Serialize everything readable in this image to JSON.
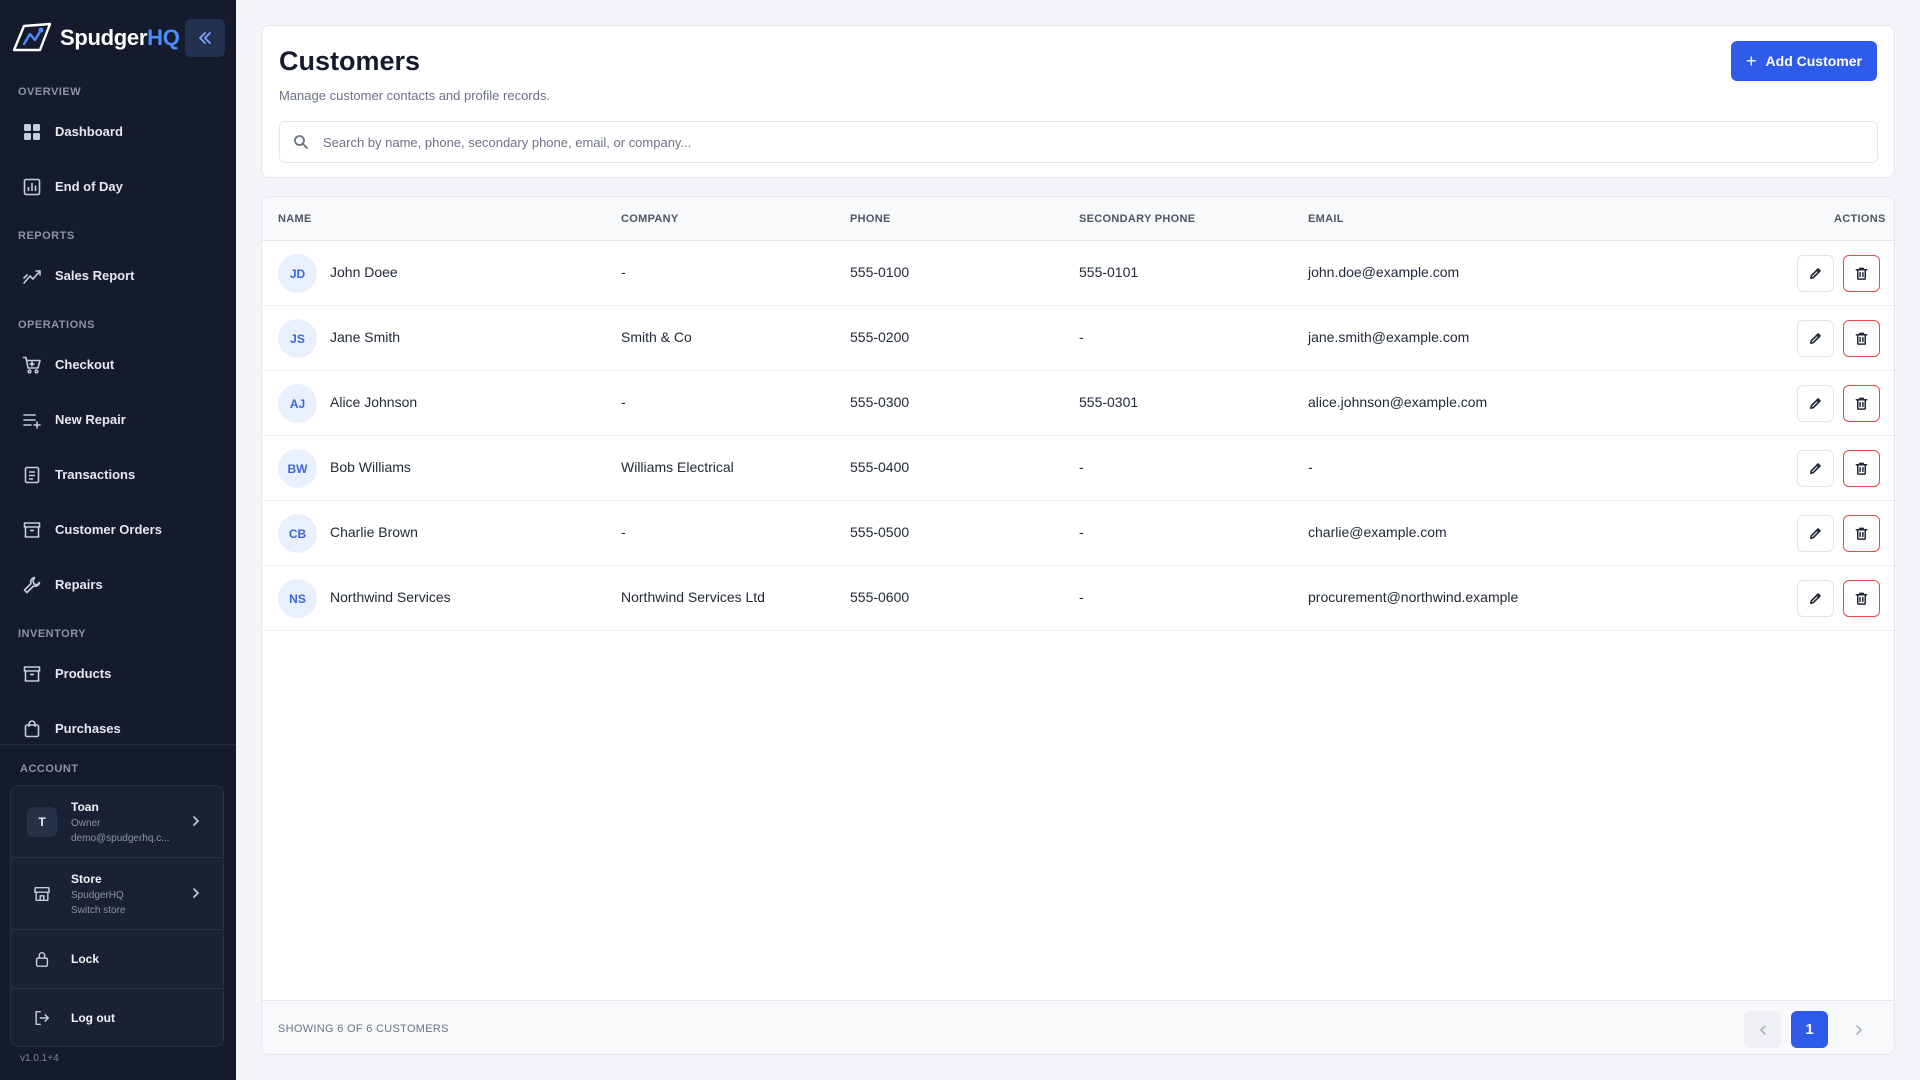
{
  "brand": {
    "name_part1": "Spudger",
    "name_part2": "HQ"
  },
  "sidebar": {
    "sections": [
      {
        "label": "OVERVIEW",
        "items": [
          {
            "label": "Dashboard",
            "icon": "dashboard-icon"
          },
          {
            "label": "End of Day",
            "icon": "chart-icon"
          }
        ]
      },
      {
        "label": "REPORTS",
        "items": [
          {
            "label": "Sales Report",
            "icon": "trend-icon"
          }
        ]
      },
      {
        "label": "OPERATIONS",
        "items": [
          {
            "label": "Checkout",
            "icon": "cart-icon"
          },
          {
            "label": "New Repair",
            "icon": "list-add-icon"
          },
          {
            "label": "Transactions",
            "icon": "receipt-icon"
          },
          {
            "label": "Customer Orders",
            "icon": "archive-icon"
          },
          {
            "label": "Repairs",
            "icon": "wrench-icon"
          }
        ]
      },
      {
        "label": "INVENTORY",
        "items": [
          {
            "label": "Products",
            "icon": "box-icon"
          },
          {
            "label": "Purchases",
            "icon": "bag-icon"
          }
        ]
      }
    ]
  },
  "account": {
    "label": "ACCOUNT",
    "user": {
      "initial": "T",
      "name": "Toan",
      "role": "Owner",
      "email": "demo@spudgerhq.c..."
    },
    "store": {
      "title": "Store",
      "name": "SpudgerHQ",
      "action": "Switch store"
    },
    "lock": "Lock",
    "logout": "Log out",
    "version": "v1.0.1+4"
  },
  "header": {
    "title": "Customers",
    "subtitle": "Manage customer contacts and profile records.",
    "add_button": "Add Customer",
    "search_placeholder": "Search by name, phone, secondary phone, email, or company..."
  },
  "table": {
    "columns": {
      "name": "NAME",
      "company": "COMPANY",
      "phone": "PHONE",
      "secondary_phone": "SECONDARY PHONE",
      "email": "EMAIL",
      "actions": "ACTIONS"
    },
    "rows": [
      {
        "initials": "JD",
        "name": "John Doee",
        "company": "-",
        "phone": "555-0100",
        "secondary_phone": "555-0101",
        "email": "john.doe@example.com"
      },
      {
        "initials": "JS",
        "name": "Jane Smith",
        "company": "Smith & Co",
        "phone": "555-0200",
        "secondary_phone": "-",
        "email": "jane.smith@example.com"
      },
      {
        "initials": "AJ",
        "name": "Alice Johnson",
        "company": "-",
        "phone": "555-0300",
        "secondary_phone": "555-0301",
        "email": "alice.johnson@example.com"
      },
      {
        "initials": "BW",
        "name": "Bob Williams",
        "company": "Williams Electrical",
        "phone": "555-0400",
        "secondary_phone": "-",
        "email": "-"
      },
      {
        "initials": "CB",
        "name": "Charlie Brown",
        "company": "-",
        "phone": "555-0500",
        "secondary_phone": "-",
        "email": "charlie@example.com"
      },
      {
        "initials": "NS",
        "name": "Northwind Services",
        "company": "Northwind Services Ltd",
        "phone": "555-0600",
        "secondary_phone": "-",
        "email": "procurement@northwind.example"
      }
    ],
    "footer_text": "SHOWING 6 OF 6 CUSTOMERS",
    "current_page": "1"
  },
  "colors": {
    "sidebar_bg": "#151b2c",
    "accent": "#2f5bea",
    "danger": "#e34b4b"
  }
}
